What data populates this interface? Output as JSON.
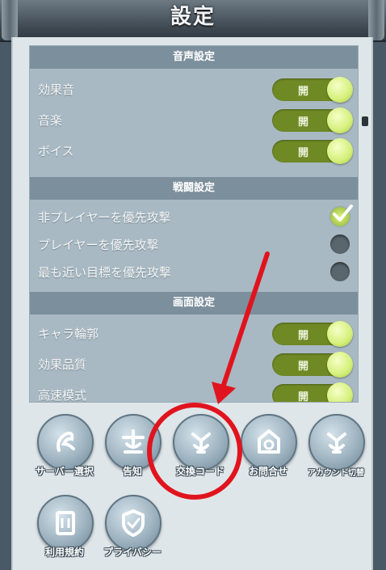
{
  "window": {
    "title": "設定"
  },
  "sections": [
    {
      "title": "音声設定",
      "rows": [
        {
          "label": "効果音",
          "toggle": "開"
        },
        {
          "label": "音楽",
          "toggle": "開"
        },
        {
          "label": "ボイス",
          "toggle": "開"
        }
      ]
    },
    {
      "title": "戦闘設定",
      "rows": [
        {
          "label": "非プレイヤーを優先攻撃",
          "selected": true
        },
        {
          "label": "プレイヤーを優先攻撃",
          "selected": false
        },
        {
          "label": "最も近い目標を優先攻撃",
          "selected": false
        }
      ]
    },
    {
      "title": "画面設定",
      "rows": [
        {
          "label": "キャラ輪郭",
          "toggle": "開"
        },
        {
          "label": "効果品質",
          "toggle": "開"
        },
        {
          "label": "高速模式",
          "toggle": "開"
        }
      ]
    }
  ],
  "menu": [
    {
      "label": "サーバー選択",
      "icon": "server-icon"
    },
    {
      "label": "告知",
      "icon": "notice-icon"
    },
    {
      "label": "交換コード",
      "icon": "exchange-code-icon"
    },
    {
      "label": "お問合せ",
      "icon": "contact-icon"
    },
    {
      "label": "アカウント切替",
      "icon": "account-switch-icon"
    },
    {
      "label": "利用規約",
      "icon": "terms-icon"
    },
    {
      "label": "プライバシー",
      "icon": "privacy-icon"
    }
  ],
  "colors": {
    "toggle_on": "#6f8a25",
    "knob": "#d4f07a",
    "section_header": "#7c8f9c",
    "annotation": "#e0141e"
  }
}
